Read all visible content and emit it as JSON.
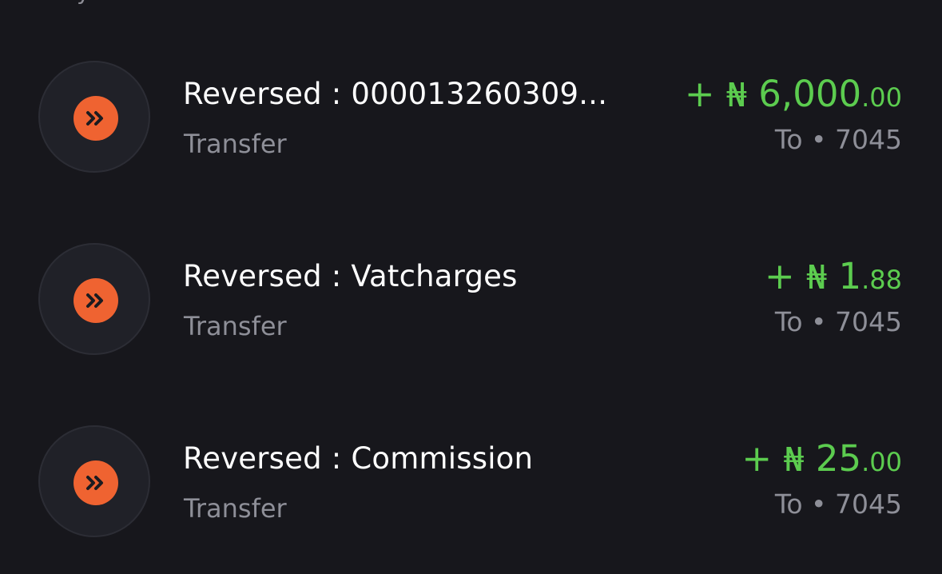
{
  "header": {
    "partial_text": "y"
  },
  "colors": {
    "background": "#17171c",
    "icon_bg": "#ef6331",
    "amount_green": "#5ccc4f",
    "muted_text": "#8e8f98"
  },
  "transactions": [
    {
      "title": "Reversed : 000013260309...",
      "type": "Transfer",
      "sign": "+",
      "currency": "₦",
      "amount_main": "6,000",
      "amount_decimal": ".00",
      "destination": "To • 7045",
      "icon": "double-chevron-right-icon"
    },
    {
      "title": "Reversed : Vatcharges",
      "type": "Transfer",
      "sign": "+",
      "currency": "₦",
      "amount_main": "1",
      "amount_decimal": ".88",
      "destination": "To • 7045",
      "icon": "double-chevron-right-icon"
    },
    {
      "title": "Reversed : Commission",
      "type": "Transfer",
      "sign": "+",
      "currency": "₦",
      "amount_main": "25",
      "amount_decimal": ".00",
      "destination": "To • 7045",
      "icon": "double-chevron-right-icon"
    }
  ]
}
